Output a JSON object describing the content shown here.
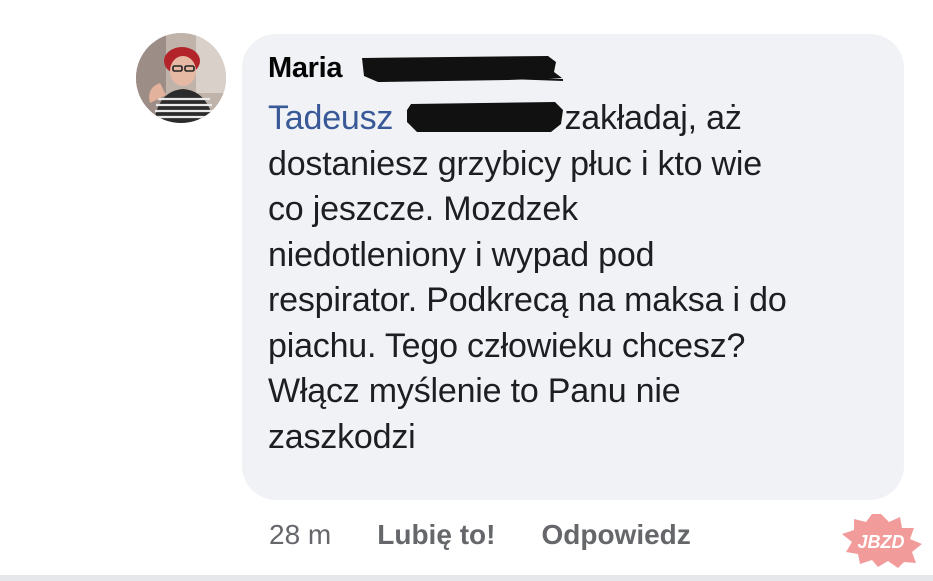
{
  "comment": {
    "author": "Maria",
    "mention": "Tadeusz",
    "text_lines": [
      "zakładaj, aż",
      "dostaniesz grzybicy płuc i kto wie",
      "co jeszcze. Mozdzek",
      "niedotleniony i wypad pod",
      "respirator. Podkrecą na maksa i do",
      "piachu. Tego człowieku chcesz?",
      "Włącz myślenie to Panu nie",
      "zaszkodzi"
    ]
  },
  "actions": {
    "time": "28 m",
    "like_label": "Lubię to!",
    "reply_label": "Odpowiedz"
  },
  "watermark": {
    "text": "JBZD"
  },
  "colors": {
    "bubble": "#f0f2f5",
    "mention": "#385898",
    "text": "#1c1e21",
    "meta": "#65676b",
    "watermark": "#f08a8a"
  }
}
